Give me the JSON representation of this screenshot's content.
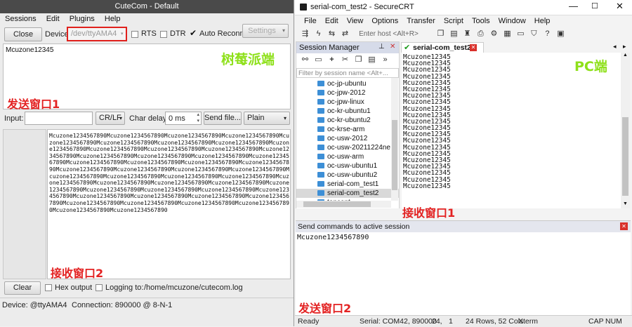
{
  "cutecom": {
    "title": "CuteCom - Default",
    "menu": [
      "Sessions",
      "Edit",
      "Plugins",
      "Help"
    ],
    "close_label": "Close",
    "device_label": "Device:",
    "device_value": "/dev/ttyAMA4",
    "rts_label": "RTS",
    "dtr_label": "DTR",
    "auto_reconnect_label": "Auto Reconnect",
    "settings_label": "Settings",
    "send_area_text": "Mcuzone12345",
    "annotation_top_right": "树莓派端",
    "annotation_send": "发送窗口1",
    "input_label": "Input:",
    "line_ending": "CR/LF",
    "char_delay_label": "Char delay:",
    "char_delay_value": "0 ms",
    "send_file_label": "Send file...",
    "format_value": "Plain",
    "received_text": "Mcuzone1234567890Mcuzone1234567890Mcuzone1234567890Mcuzone1234567890Mcuzone1234567890Mcuzone1234567890Mcuzone1234567890Mcuzone1234567890Mcuzone1234567890Mcuzone1234567890Mcuzone1234567890Mcuzone1234567890Mcuzone1234567890Mcuzone1234567890Mcuzone1234567890Mcuzone1234567890Mcuzone1234567890Mcuzone1234567890Mcuzone1234567890Mcuzone1234567890Mcuzone1234567890Mcuzone1234567890Mcuzone1234567890Mcuzone1234567890Mcuzone1234567890Mcuzone1234567890Mcuzone1234567890Mcuzone1234567890Mcuzone1234567890Mcuzone1234567890Mcuzone1234567890Mcuzone1234567890Mcuzone1234567890Mcuzone1234567890Mcuzone1234567890Mcuzone1234567890Mcuzone1234567890Mcuzone1234567890Mcuzone1234567890Mcuzone1234567890Mcuzone1234567890Mcuzone1234567890Mcuzone1234567890Mcuzone1234567890Mcuzone1234567890Mcuzone1234567890Mcuzone1234567890Mcuzone1234567890",
    "annotation_recv": "接收窗口2",
    "clear_label": "Clear",
    "hex_output_label": "Hex output",
    "logging_label": "Logging to:",
    "log_path": "/home/mcuzone/cutecom.log",
    "status_device": "Device:   @ttyAMA4",
    "status_connection": "Connection:  890000 @ 8-N-1"
  },
  "securecrt": {
    "title": "serial-com_test2 - SecureCRT",
    "menu": [
      "File",
      "Edit",
      "View",
      "Options",
      "Transfer",
      "Script",
      "Tools",
      "Window",
      "Help"
    ],
    "host_placeholder": "Enter host <Alt+R>",
    "session_manager_title": "Session Manager",
    "filter_placeholder": "Filter by session name <Alt+...",
    "sessions": [
      "oc-jp-ubuntu",
      "oc-jpw-2012",
      "oc-jpw-linux",
      "oc-kr-ubuntu1",
      "oc-kr-ubuntu2",
      "oc-krse-arm",
      "oc-usw-2012",
      "oc-usw-20211224ne",
      "oc-usw-arm",
      "oc-usw-ubuntu1",
      "oc-usw-ubuntu2",
      "serial-com_test1",
      "serial-com_test2",
      "tencent"
    ],
    "selected_session": "serial-com_test2",
    "tab_label": "serial-com_test2",
    "annotation_pc": "PC端",
    "terminal_lines": [
      "Mcuzone12345",
      "Mcuzone12345",
      "Mcuzone12345",
      "Mcuzone12345",
      "Mcuzone12345",
      "Mcuzone12345",
      "Mcuzone12345",
      "Mcuzone12345",
      "Mcuzone12345",
      "Mcuzone12345",
      "Mcuzone12345",
      "Mcuzone12345",
      "Mcuzone12345",
      "Mcuzone12345",
      "Mcuzone12345",
      "Mcuzone12345",
      "Mcuzone12345",
      "Mcuzone12345",
      "Mcuzone12345",
      "Mcuzone12345",
      "Mcuzone12345"
    ],
    "annotation_recv": "接收窗口1",
    "command_window_title": "Send commands to active session",
    "command_text": "Mcuzone1234567890",
    "annotation_send": "发送窗口2",
    "status": {
      "ready": "Ready",
      "serial": "Serial: COM42, 890000",
      "pos_row": "24,",
      "pos_col": "1",
      "size": "24 Rows, 52 Cols",
      "term": "Xterm",
      "cap": "CAP",
      "num": "NUM"
    }
  },
  "colors": {
    "annotation_red": "#e32222",
    "annotation_green": "#8ee01a",
    "highlight_box": "#e0201c"
  }
}
